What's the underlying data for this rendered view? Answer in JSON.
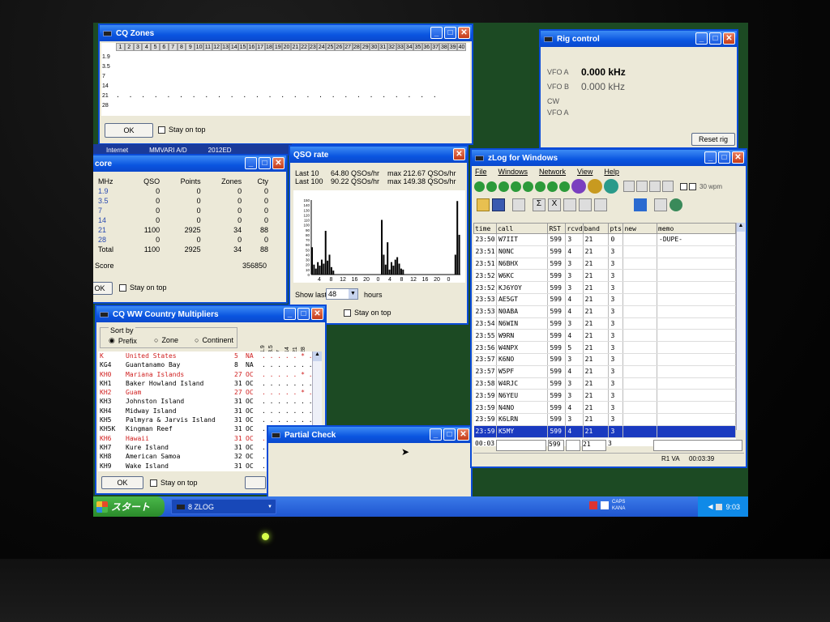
{
  "cq_zones": {
    "title": "CQ Zones",
    "zones": [
      "1",
      "2",
      "3",
      "4",
      "5",
      "6",
      "7",
      "8",
      "9",
      "10",
      "11",
      "12",
      "13",
      "14",
      "15",
      "16",
      "17",
      "18",
      "19",
      "20",
      "21",
      "22",
      "23",
      "24",
      "25",
      "26",
      "27",
      "28",
      "29",
      "30",
      "31",
      "32",
      "33",
      "34",
      "35",
      "36",
      "37",
      "38",
      "39",
      "40"
    ],
    "bands": [
      "1.9",
      "3.5",
      "7",
      "14",
      "21",
      "28"
    ],
    "ok": "OK",
    "stay_on_top": "Stay on top"
  },
  "rig": {
    "title": "Rig control",
    "vfoa_label": "VFO A",
    "vfoa_value": "0.000 kHz",
    "vfob_label": "VFO B",
    "vfob_value": "0.000 kHz",
    "mode": "CW",
    "vfo_sel": "VFO A",
    "reset": "Reset rig"
  },
  "strip": {
    "c1": "Internet",
    "c2": "MMVARI A/D",
    "c3": "2012ED"
  },
  "score": {
    "title": "core",
    "headers": [
      "MHz",
      "QSO",
      "Points",
      "Zones",
      "Cty"
    ],
    "rows": [
      [
        "1.9",
        "0",
        "0",
        "0",
        "0"
      ],
      [
        "3.5",
        "0",
        "0",
        "0",
        "0"
      ],
      [
        "7",
        "0",
        "0",
        "0",
        "0"
      ],
      [
        "14",
        "0",
        "0",
        "0",
        "0"
      ],
      [
        "21",
        "1100",
        "2925",
        "34",
        "88"
      ],
      [
        "28",
        "0",
        "0",
        "0",
        "0"
      ],
      [
        "Total",
        "1100",
        "2925",
        "34",
        "88"
      ]
    ],
    "score_label": "Score",
    "score_value": "356850",
    "ok": "OK",
    "stay_on_top": "Stay on top"
  },
  "rate": {
    "title": "QSO rate",
    "last10": "Last 10",
    "last10_val": "64.80 QSOs/hr",
    "last10_max": "max 212.67 QSOs/hr",
    "last100": "Last 100",
    "last100_val": "90.22 QSOs/hr",
    "last100_max": "max 149.38 QSOs/hr",
    "yticks": [
      "150",
      "140",
      "130",
      "120",
      "110",
      "100",
      "90",
      "80",
      "70",
      "60",
      "50",
      "40",
      "30",
      "20",
      "10",
      "0"
    ],
    "xticks": [
      "4",
      "8",
      "12",
      "16",
      "20",
      "0",
      "4",
      "8",
      "12",
      "16",
      "20",
      "0"
    ],
    "show_last": "Show last",
    "hours_val": "48",
    "hours": "hours",
    "stay_on_top": "Stay on top"
  },
  "chart_data": {
    "type": "bar",
    "title": "",
    "xlabel": "",
    "ylabel": "",
    "ylim": [
      0,
      150
    ],
    "values": [
      55,
      20,
      12,
      25,
      18,
      30,
      22,
      88,
      28,
      40,
      15,
      8,
      0,
      0,
      0,
      0,
      0,
      0,
      0,
      0,
      0,
      0,
      0,
      0,
      0,
      0,
      0,
      0,
      0,
      0,
      0,
      0,
      0,
      0,
      0,
      0,
      110,
      40,
      20,
      65,
      10,
      25,
      18,
      30,
      35,
      22,
      12,
      10,
      0,
      0,
      0,
      0,
      0,
      0,
      0,
      0,
      0,
      0,
      0,
      0,
      0,
      0,
      0,
      0,
      0,
      0,
      0,
      0,
      0,
      0,
      0,
      0,
      0,
      0,
      40,
      148,
      80
    ]
  },
  "country": {
    "title": "CQ WW Country Multipliers",
    "sort_by": "Sort by",
    "opt_prefix": "Prefix",
    "opt_zone": "Zone",
    "opt_continent": "Continent",
    "band_heads": [
      "1.9",
      "3.5",
      "7",
      "14",
      "21",
      "28"
    ],
    "rows": [
      {
        "p": "K",
        "n": "United States",
        "z": "5",
        "c": "NA",
        "d": ". . . . . * .",
        "r": true
      },
      {
        "p": "KG4",
        "n": "Guantanamo Bay",
        "z": "8",
        "c": "NA",
        "d": ". . . . . . .",
        "r": false
      },
      {
        "p": "KH0",
        "n": "Mariana Islands",
        "z": "27",
        "c": "OC",
        "d": ". . . . . * .",
        "r": true
      },
      {
        "p": "KH1",
        "n": "Baker Howland Island",
        "z": "31",
        "c": "OC",
        "d": ". . . . . . .",
        "r": false
      },
      {
        "p": "KH2",
        "n": "Guam",
        "z": "27",
        "c": "OC",
        "d": ". . . . . * .",
        "r": true
      },
      {
        "p": "KH3",
        "n": "Johnston Island",
        "z": "31",
        "c": "OC",
        "d": ". . . . . . .",
        "r": false
      },
      {
        "p": "KH4",
        "n": "Midway Island",
        "z": "31",
        "c": "OC",
        "d": ". . . . . . .",
        "r": false
      },
      {
        "p": "KH5",
        "n": "Palmyra & Jarvis Island",
        "z": "31",
        "c": "OC",
        "d": ". . . . . . .",
        "r": false
      },
      {
        "p": "KH5K",
        "n": "Kingman Reef",
        "z": "31",
        "c": "OC",
        "d": ". . . . . . .",
        "r": false
      },
      {
        "p": "KH6",
        "n": "Hawaii",
        "z": "31",
        "c": "OC",
        "d": ". . . . . * .",
        "r": true
      },
      {
        "p": "KH7",
        "n": "Kure Island",
        "z": "31",
        "c": "OC",
        "d": ". . . . . . .",
        "r": false
      },
      {
        "p": "KH8",
        "n": "American Samoa",
        "z": "32",
        "c": "OC",
        "d": ". . . . . . .",
        "r": false
      },
      {
        "p": "KH9",
        "n": "Wake Island",
        "z": "31",
        "c": "OC",
        "d": ". . . . . . .",
        "r": false
      }
    ],
    "ok": "OK",
    "stay_on_top": "Stay on top"
  },
  "partial": {
    "title": "Partial Check"
  },
  "zlog": {
    "title": "zLog for Windows",
    "menu": [
      "File",
      "Windows",
      "Network",
      "View",
      "Help"
    ],
    "speed": "30 wpm",
    "headers": [
      "time",
      "call",
      "RST",
      "rcvd",
      "band",
      "pts",
      "new",
      "memo"
    ],
    "rows": [
      [
        "23:50",
        "W7IIT",
        "599",
        "3",
        "21",
        "0",
        "",
        "-DUPE-"
      ],
      [
        "23:51",
        "N0NC",
        "599",
        "4",
        "21",
        "3",
        "",
        ""
      ],
      [
        "23:51",
        "N6BHX",
        "599",
        "3",
        "21",
        "3",
        "",
        ""
      ],
      [
        "23:52",
        "W6KC",
        "599",
        "3",
        "21",
        "3",
        "",
        ""
      ],
      [
        "23:52",
        "KJ6YOY",
        "599",
        "3",
        "21",
        "3",
        "",
        ""
      ],
      [
        "23:53",
        "AE5GT",
        "599",
        "4",
        "21",
        "3",
        "",
        ""
      ],
      [
        "23:53",
        "N0ABA",
        "599",
        "4",
        "21",
        "3",
        "",
        ""
      ],
      [
        "23:54",
        "N6WIN",
        "599",
        "3",
        "21",
        "3",
        "",
        ""
      ],
      [
        "23:55",
        "W9RN",
        "599",
        "4",
        "21",
        "3",
        "",
        ""
      ],
      [
        "23:56",
        "W4NPX",
        "599",
        "5",
        "21",
        "3",
        "",
        ""
      ],
      [
        "23:57",
        "K6NO",
        "599",
        "3",
        "21",
        "3",
        "",
        ""
      ],
      [
        "23:57",
        "W5PF",
        "599",
        "4",
        "21",
        "3",
        "",
        ""
      ],
      [
        "23:58",
        "W4RJC",
        "599",
        "3",
        "21",
        "3",
        "",
        ""
      ],
      [
        "23:59",
        "N6YEU",
        "599",
        "3",
        "21",
        "3",
        "",
        ""
      ],
      [
        "23:59",
        "N4NO",
        "599",
        "4",
        "21",
        "3",
        "",
        ""
      ],
      [
        "23:59",
        "K6LRN",
        "599",
        "3",
        "21",
        "3",
        "",
        ""
      ],
      [
        "23:59",
        "K5MY",
        "599",
        "4",
        "21",
        "3",
        "",
        ""
      ]
    ],
    "entry": {
      "time": "00:03",
      "call": "",
      "rst": "599",
      "rcvd": "",
      "band": "21",
      "pts": "3"
    },
    "status_rig": "R1 VA",
    "status_time": "00:03:39"
  },
  "taskbar": {
    "start": "スタート",
    "task": "8 ZLOG",
    "caps": "CAPS",
    "kana": "KANA",
    "clock": "9:03"
  }
}
